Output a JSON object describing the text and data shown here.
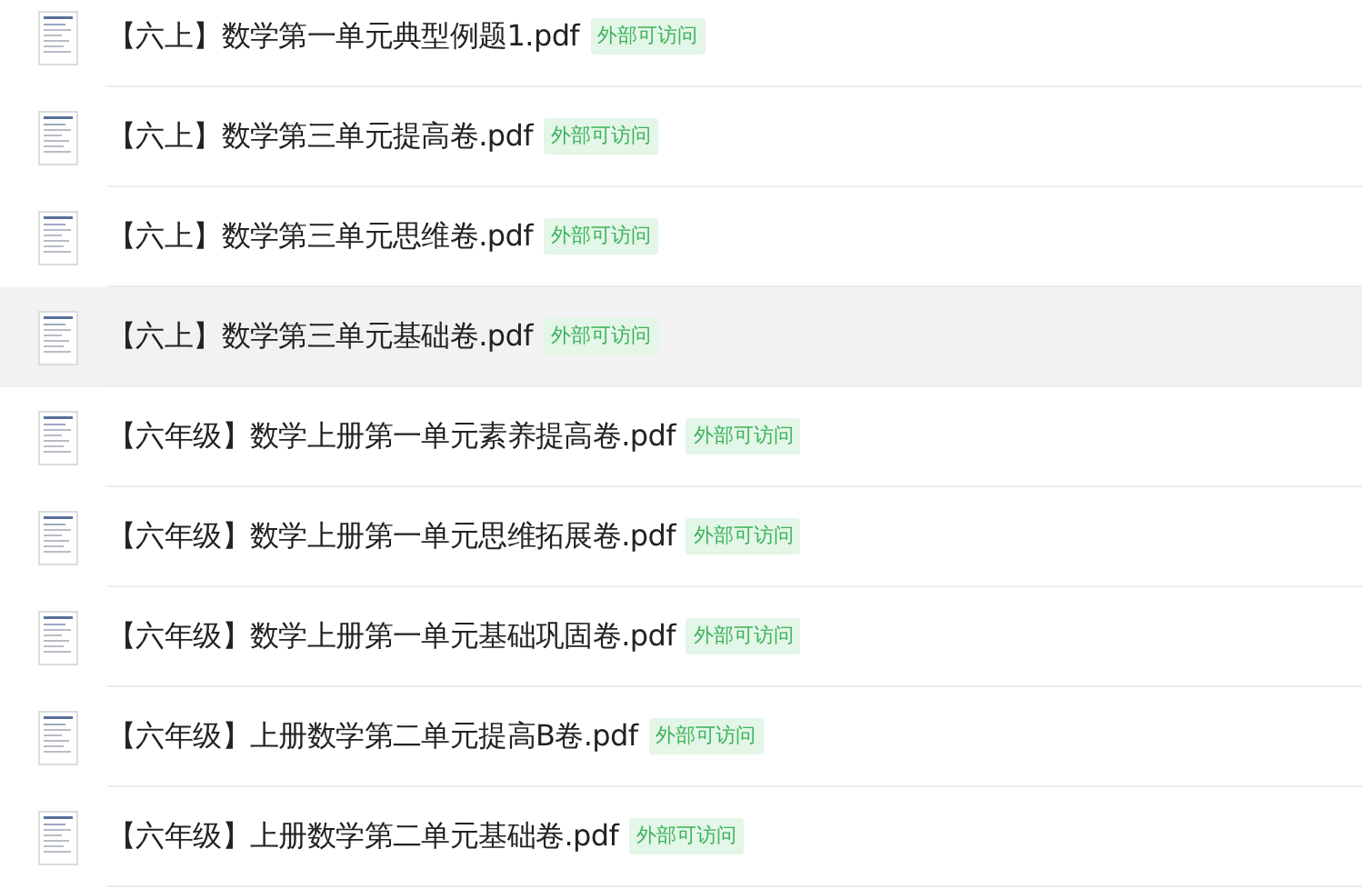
{
  "files": [
    {
      "name": "【六上】数学第一单元典型例题1.pdf",
      "badge": "外部可访问",
      "selected": false
    },
    {
      "name": "【六上】数学第三单元提高卷.pdf",
      "badge": "外部可访问",
      "selected": false
    },
    {
      "name": "【六上】数学第三单元思维卷.pdf",
      "badge": "外部可访问",
      "selected": false
    },
    {
      "name": "【六上】数学第三单元基础卷.pdf",
      "badge": "外部可访问",
      "selected": true
    },
    {
      "name": "【六年级】数学上册第一单元素养提高卷.pdf",
      "badge": "外部可访问",
      "selected": false
    },
    {
      "name": "【六年级】数学上册第一单元思维拓展卷.pdf",
      "badge": "外部可访问",
      "selected": false
    },
    {
      "name": "【六年级】数学上册第一单元基础巩固卷.pdf",
      "badge": "外部可访问",
      "selected": false
    },
    {
      "name": "【六年级】上册数学第二单元提高B卷.pdf",
      "badge": "外部可访问",
      "selected": false
    },
    {
      "name": "【六年级】上册数学第二单元基础卷.pdf",
      "badge": "外部可访问",
      "selected": false
    }
  ]
}
